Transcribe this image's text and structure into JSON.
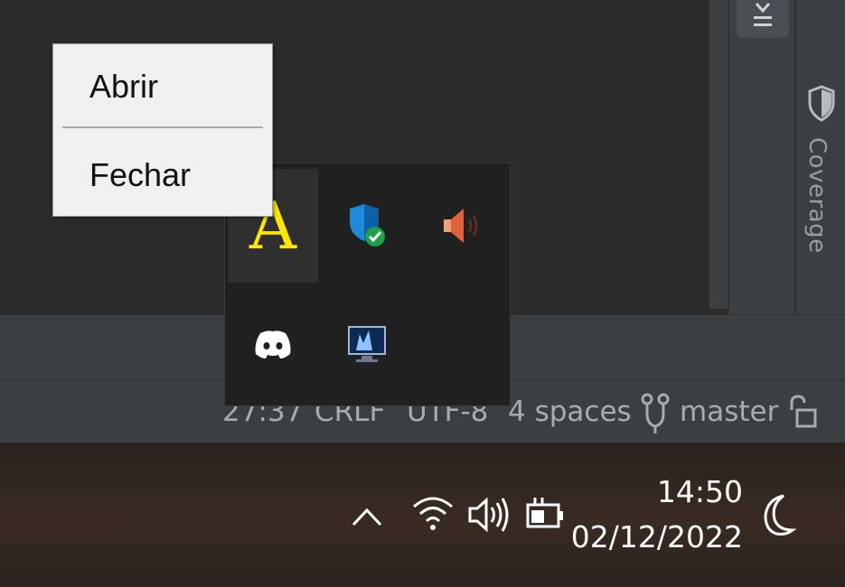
{
  "context_menu": {
    "items": [
      {
        "label": "Abrir"
      },
      {
        "label": "Fechar"
      }
    ]
  },
  "tray_flyout": {
    "icons": [
      "font-a-icon",
      "windows-security-icon",
      "speaker-muted-icon",
      "discord-icon",
      "monitor-app-icon"
    ],
    "font_letter": "A"
  },
  "ide": {
    "right_panel": {
      "coverage_label": "Coverage"
    },
    "status_bar": {
      "position": "27:37",
      "line_ending": "CRLF",
      "encoding": "UTF-8",
      "indent": "4 spaces",
      "branch": "master"
    }
  },
  "taskbar": {
    "time": "14:50",
    "date": "02/12/2022"
  },
  "colors": {
    "accent_yellow": "#ffe600",
    "status_text": "#a9abad"
  }
}
